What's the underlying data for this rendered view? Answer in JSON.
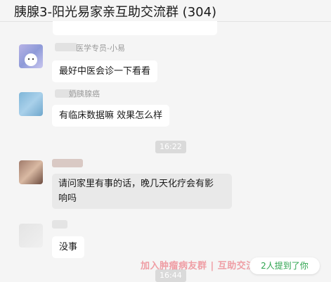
{
  "header": {
    "title": "胰腺3-阳光易家亲互助交流群 (304)"
  },
  "messages": [
    {
      "sender": "医学专员-小易",
      "text": "最好中医会诊一下看看"
    },
    {
      "sender": "奶胰腺癌",
      "text": "有临床数据嘛 效果怎么样"
    },
    {
      "time": "16:22"
    },
    {
      "sender": "",
      "text": "请问家里有事的话，晚几天化疗会有影响吗",
      "line1": "请问家里有事的话，晚几天化疗会有影",
      "line2": "响吗"
    },
    {
      "sender": "",
      "text": "没事"
    },
    {
      "time": "16:44"
    }
  ],
  "overlay": {
    "watermark": "加入肿瘤病友群 | 互助交流",
    "mention": "2人提到了你"
  },
  "colors": {
    "accent": "#2ea44f",
    "watermark": "#ec7882"
  }
}
